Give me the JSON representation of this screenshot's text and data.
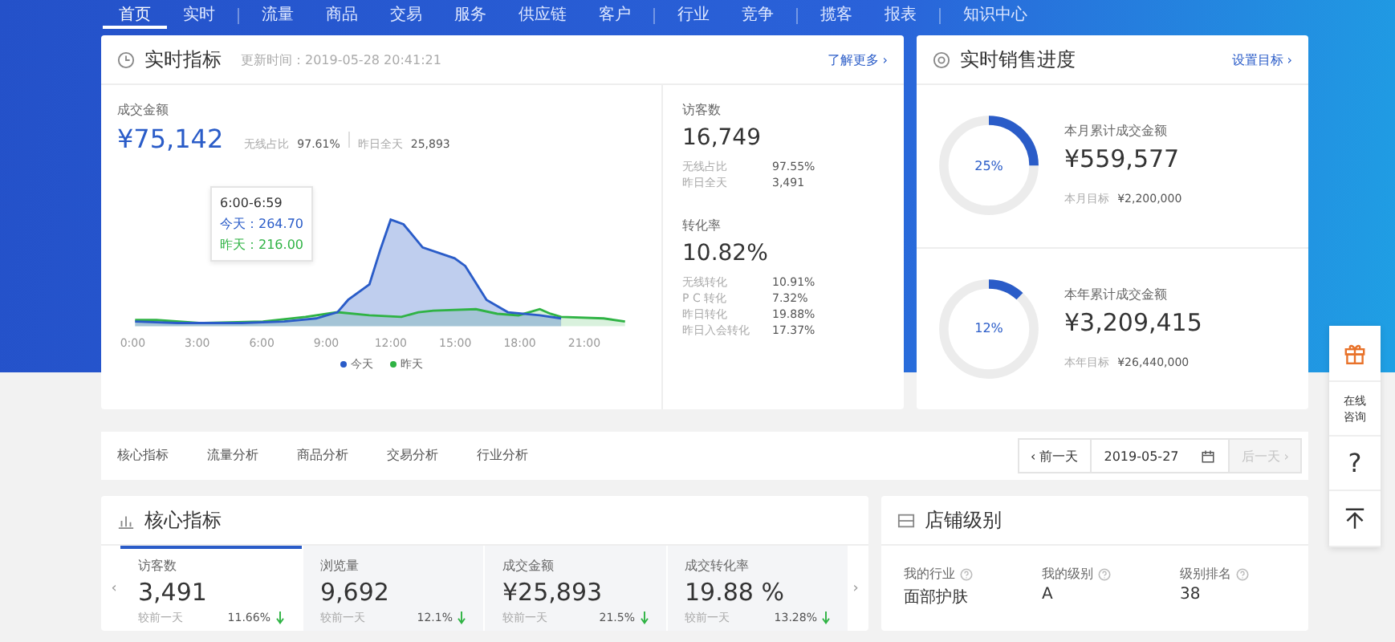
{
  "nav": [
    [
      {
        "label": "首页",
        "selected": true
      },
      {
        "label": "实时",
        "selected": false
      }
    ],
    [
      {
        "label": "流量",
        "selected": false
      },
      {
        "label": "商品",
        "selected": false
      },
      {
        "label": "交易",
        "selected": false
      },
      {
        "label": "服务",
        "selected": false
      },
      {
        "label": "供应链",
        "selected": false
      },
      {
        "label": "客户",
        "selected": false
      }
    ],
    [
      {
        "label": "行业",
        "selected": false
      },
      {
        "label": "竞争",
        "selected": false
      }
    ],
    [
      {
        "label": "揽客",
        "selected": false
      },
      {
        "label": "报表",
        "selected": false
      }
    ],
    [
      {
        "label": "知识中心",
        "selected": false
      }
    ]
  ],
  "realtime": {
    "title": "实时指标",
    "update_time": "更新时间：2019-05-28 20:41:21",
    "more_link": "了解更多 ›",
    "amount": {
      "label": "成交金额",
      "value": "¥75,142",
      "stats": [
        {
          "label": "无线占比",
          "value": "97.61%"
        },
        {
          "label": "昨日全天",
          "value": "25,893"
        }
      ]
    },
    "chart": {
      "x_ticks": [
        "0:00",
        "3:00",
        "6:00",
        "9:00",
        "12:00",
        "15:00",
        "18:00",
        "21:00"
      ],
      "legend": [
        {
          "label": "今天",
          "color": "#2a5cc8"
        },
        {
          "label": "昨天",
          "color": "#2fb344"
        }
      ],
      "tooltip": {
        "time": "6:00-6:59",
        "rows": [
          {
            "label": "今天：264.70",
            "color": "#2a5cc8"
          },
          {
            "label": "昨天：216.00",
            "color": "#2fb344"
          }
        ]
      }
    },
    "side_metrics": [
      {
        "label": "访客数",
        "value": "16,749",
        "stats": [
          {
            "label": "无线占比",
            "value": "97.55%"
          },
          {
            "label": "昨日全天",
            "value": "3,491"
          }
        ]
      },
      {
        "label": "转化率",
        "value": "10.82%",
        "stats": [
          {
            "label": "无线转化",
            "value": "10.91%"
          },
          {
            "label": "P C 转化",
            "value": "7.32%"
          },
          {
            "label": "昨日转化",
            "value": "19.88%"
          },
          {
            "label": "昨日入会转化",
            "value": "17.37%"
          }
        ]
      }
    ]
  },
  "sales_progress": {
    "title": "实时销售进度",
    "link": "设置目标 ›",
    "items": [
      {
        "level": 0.25,
        "percent": "25%",
        "label": "本月累计成交金额",
        "value": "¥559,577",
        "target_label": "本月目标",
        "target_value": "¥2,200,000"
      },
      {
        "level": 0.12,
        "percent": "12%",
        "label": "本年累计成交金额",
        "value": "¥3,209,415",
        "target_label": "本年目标",
        "target_value": "¥26,440,000"
      }
    ]
  },
  "tabs": [
    {
      "label": "核心指标",
      "selected": false
    },
    {
      "label": "流量分析",
      "selected": false
    },
    {
      "label": "商品分析",
      "selected": false
    },
    {
      "label": "交易分析",
      "selected": false
    },
    {
      "label": "行业分析",
      "selected": false
    }
  ],
  "date_nav": {
    "prev": "‹ 前一天",
    "date": "2019-05-27",
    "next": "后一天 ›",
    "next_disabled": true
  },
  "side_tools": [
    {
      "kind": "gift"
    },
    {
      "kind": "text",
      "label": "在线咨询"
    },
    {
      "kind": "text",
      "label": "?"
    },
    {
      "kind": "top"
    }
  ],
  "core": {
    "title": "核心指标",
    "scroll_left": "‹",
    "scroll_right": "›",
    "metrics": [
      {
        "label": "访客数",
        "value": "3,491",
        "compare": "较前一天",
        "change": "11.66%",
        "selected": true
      },
      {
        "label": "浏览量",
        "value": "9,692",
        "compare": "较前一天",
        "change": "12.1%",
        "selected": false
      },
      {
        "label": "成交金额",
        "value": "¥25,893",
        "compare": "较前一天",
        "change": "21.5%",
        "selected": false
      },
      {
        "label": "成交转化率",
        "value": "19.88 %",
        "compare": "较前一天",
        "change": "13.28%",
        "selected": false
      }
    ]
  },
  "shop_level": {
    "title": "店铺级别",
    "fields": [
      {
        "label": "我的行业",
        "value": "面部护肤"
      },
      {
        "label": "我的级别",
        "value": "A"
      },
      {
        "label": "级别排名",
        "value": "38"
      }
    ]
  }
}
